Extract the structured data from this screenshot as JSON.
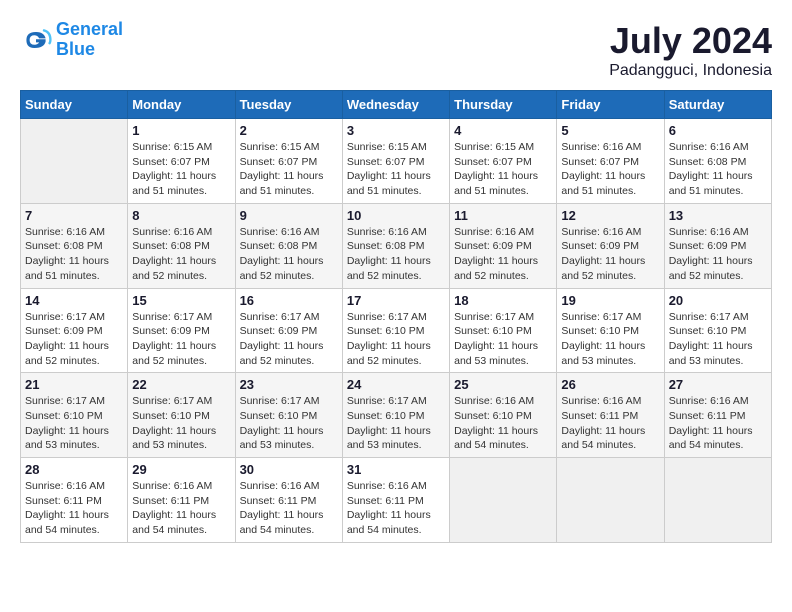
{
  "logo": {
    "line1": "General",
    "line2": "Blue"
  },
  "title": "July 2024",
  "subtitle": "Padangguci, Indonesia",
  "days_header": [
    "Sunday",
    "Monday",
    "Tuesday",
    "Wednesday",
    "Thursday",
    "Friday",
    "Saturday"
  ],
  "weeks": [
    [
      {
        "num": "",
        "info": ""
      },
      {
        "num": "1",
        "info": "Sunrise: 6:15 AM\nSunset: 6:07 PM\nDaylight: 11 hours\nand 51 minutes."
      },
      {
        "num": "2",
        "info": "Sunrise: 6:15 AM\nSunset: 6:07 PM\nDaylight: 11 hours\nand 51 minutes."
      },
      {
        "num": "3",
        "info": "Sunrise: 6:15 AM\nSunset: 6:07 PM\nDaylight: 11 hours\nand 51 minutes."
      },
      {
        "num": "4",
        "info": "Sunrise: 6:15 AM\nSunset: 6:07 PM\nDaylight: 11 hours\nand 51 minutes."
      },
      {
        "num": "5",
        "info": "Sunrise: 6:16 AM\nSunset: 6:07 PM\nDaylight: 11 hours\nand 51 minutes."
      },
      {
        "num": "6",
        "info": "Sunrise: 6:16 AM\nSunset: 6:08 PM\nDaylight: 11 hours\nand 51 minutes."
      }
    ],
    [
      {
        "num": "7",
        "info": "Sunrise: 6:16 AM\nSunset: 6:08 PM\nDaylight: 11 hours\nand 51 minutes."
      },
      {
        "num": "8",
        "info": "Sunrise: 6:16 AM\nSunset: 6:08 PM\nDaylight: 11 hours\nand 52 minutes."
      },
      {
        "num": "9",
        "info": "Sunrise: 6:16 AM\nSunset: 6:08 PM\nDaylight: 11 hours\nand 52 minutes."
      },
      {
        "num": "10",
        "info": "Sunrise: 6:16 AM\nSunset: 6:08 PM\nDaylight: 11 hours\nand 52 minutes."
      },
      {
        "num": "11",
        "info": "Sunrise: 6:16 AM\nSunset: 6:09 PM\nDaylight: 11 hours\nand 52 minutes."
      },
      {
        "num": "12",
        "info": "Sunrise: 6:16 AM\nSunset: 6:09 PM\nDaylight: 11 hours\nand 52 minutes."
      },
      {
        "num": "13",
        "info": "Sunrise: 6:16 AM\nSunset: 6:09 PM\nDaylight: 11 hours\nand 52 minutes."
      }
    ],
    [
      {
        "num": "14",
        "info": "Sunrise: 6:17 AM\nSunset: 6:09 PM\nDaylight: 11 hours\nand 52 minutes."
      },
      {
        "num": "15",
        "info": "Sunrise: 6:17 AM\nSunset: 6:09 PM\nDaylight: 11 hours\nand 52 minutes."
      },
      {
        "num": "16",
        "info": "Sunrise: 6:17 AM\nSunset: 6:09 PM\nDaylight: 11 hours\nand 52 minutes."
      },
      {
        "num": "17",
        "info": "Sunrise: 6:17 AM\nSunset: 6:10 PM\nDaylight: 11 hours\nand 52 minutes."
      },
      {
        "num": "18",
        "info": "Sunrise: 6:17 AM\nSunset: 6:10 PM\nDaylight: 11 hours\nand 53 minutes."
      },
      {
        "num": "19",
        "info": "Sunrise: 6:17 AM\nSunset: 6:10 PM\nDaylight: 11 hours\nand 53 minutes."
      },
      {
        "num": "20",
        "info": "Sunrise: 6:17 AM\nSunset: 6:10 PM\nDaylight: 11 hours\nand 53 minutes."
      }
    ],
    [
      {
        "num": "21",
        "info": "Sunrise: 6:17 AM\nSunset: 6:10 PM\nDaylight: 11 hours\nand 53 minutes."
      },
      {
        "num": "22",
        "info": "Sunrise: 6:17 AM\nSunset: 6:10 PM\nDaylight: 11 hours\nand 53 minutes."
      },
      {
        "num": "23",
        "info": "Sunrise: 6:17 AM\nSunset: 6:10 PM\nDaylight: 11 hours\nand 53 minutes."
      },
      {
        "num": "24",
        "info": "Sunrise: 6:17 AM\nSunset: 6:10 PM\nDaylight: 11 hours\nand 53 minutes."
      },
      {
        "num": "25",
        "info": "Sunrise: 6:16 AM\nSunset: 6:10 PM\nDaylight: 11 hours\nand 54 minutes."
      },
      {
        "num": "26",
        "info": "Sunrise: 6:16 AM\nSunset: 6:11 PM\nDaylight: 11 hours\nand 54 minutes."
      },
      {
        "num": "27",
        "info": "Sunrise: 6:16 AM\nSunset: 6:11 PM\nDaylight: 11 hours\nand 54 minutes."
      }
    ],
    [
      {
        "num": "28",
        "info": "Sunrise: 6:16 AM\nSunset: 6:11 PM\nDaylight: 11 hours\nand 54 minutes."
      },
      {
        "num": "29",
        "info": "Sunrise: 6:16 AM\nSunset: 6:11 PM\nDaylight: 11 hours\nand 54 minutes."
      },
      {
        "num": "30",
        "info": "Sunrise: 6:16 AM\nSunset: 6:11 PM\nDaylight: 11 hours\nand 54 minutes."
      },
      {
        "num": "31",
        "info": "Sunrise: 6:16 AM\nSunset: 6:11 PM\nDaylight: 11 hours\nand 54 minutes."
      },
      {
        "num": "",
        "info": ""
      },
      {
        "num": "",
        "info": ""
      },
      {
        "num": "",
        "info": ""
      }
    ]
  ]
}
